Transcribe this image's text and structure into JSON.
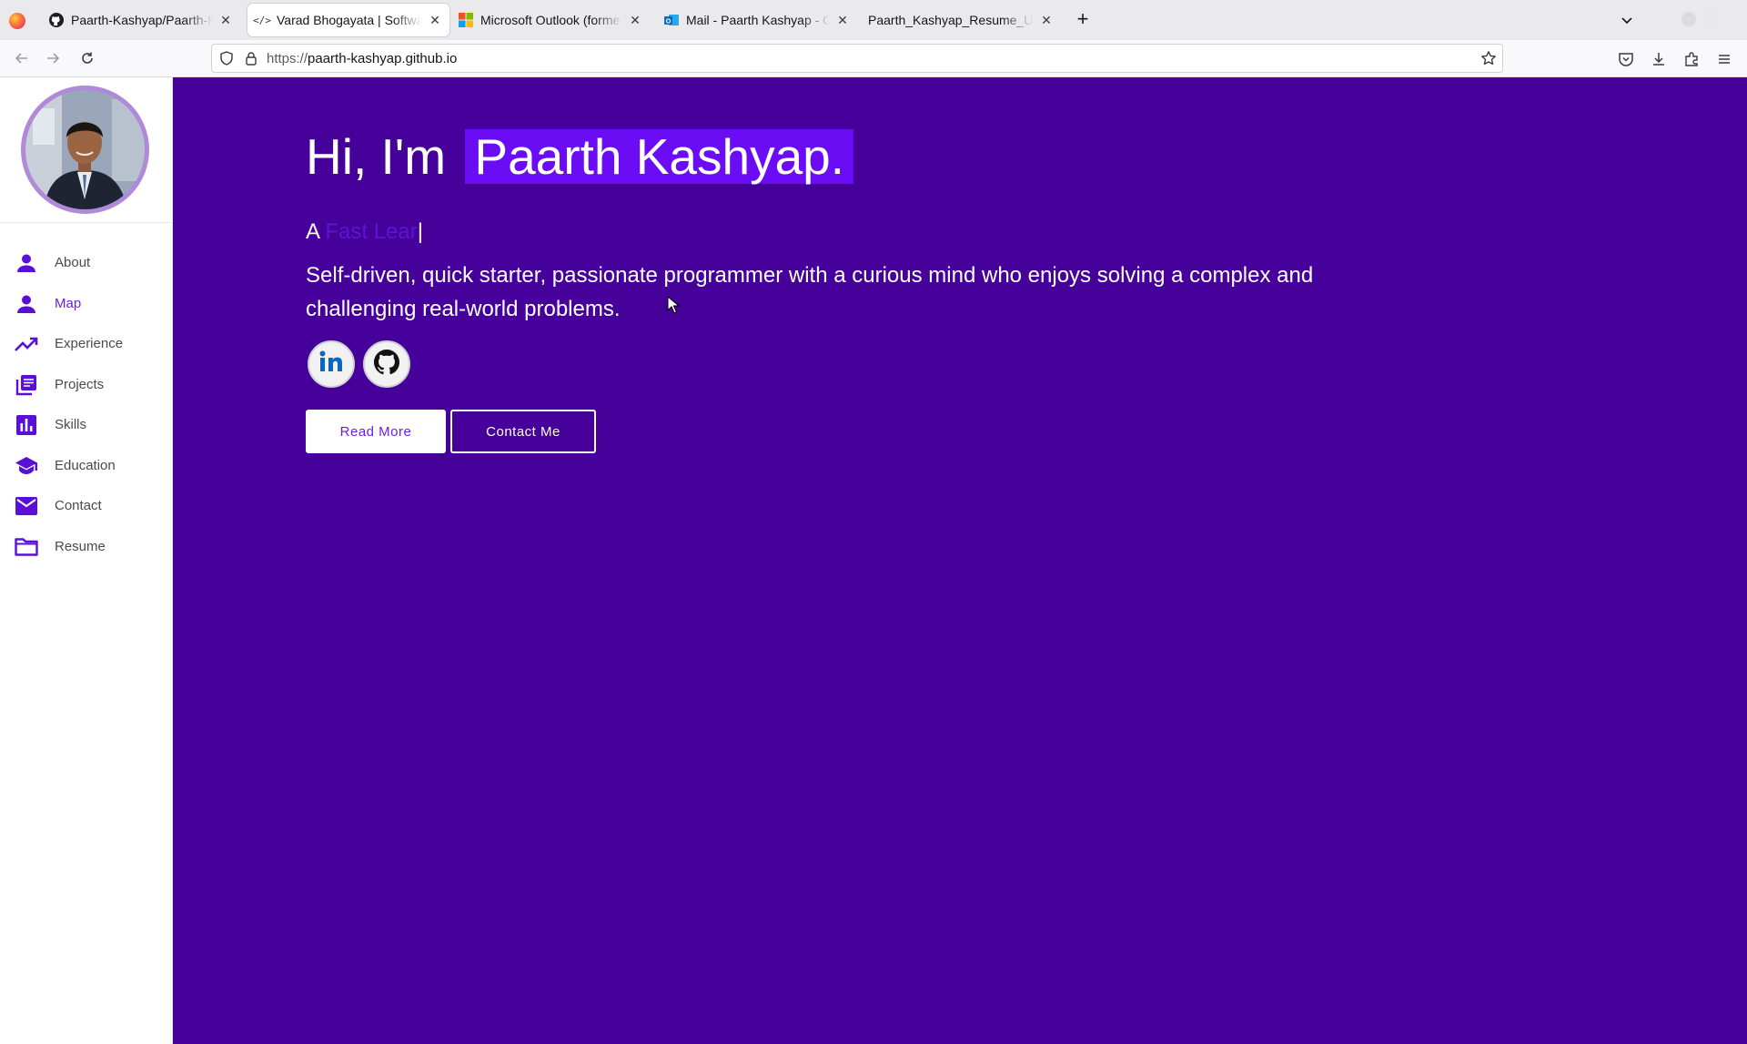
{
  "browser": {
    "tabs": [
      {
        "title": "Paarth-Kashyap/Paarth-K",
        "favicon": "github-icon",
        "active": false
      },
      {
        "title": "Varad Bhogayata | Softwa",
        "favicon": "code-icon",
        "active": true
      },
      {
        "title": "Microsoft Outlook (forme",
        "favicon": "microsoft-icon",
        "active": false
      },
      {
        "title": "Mail - Paarth Kashyap - O",
        "favicon": "outlook-icon",
        "active": false
      },
      {
        "title": "Paarth_Kashyap_Resume_Uc",
        "favicon": "",
        "active": false
      }
    ],
    "url_scheme": "https://",
    "url_host": "paarth-kashyap.github.io"
  },
  "sidebar": {
    "items": [
      {
        "label": "About",
        "icon": "person-icon"
      },
      {
        "label": "Map",
        "icon": "person-icon"
      },
      {
        "label": "Experience",
        "icon": "trending-up-icon"
      },
      {
        "label": "Projects",
        "icon": "articles-icon"
      },
      {
        "label": "Skills",
        "icon": "bar-chart-icon"
      },
      {
        "label": "Education",
        "icon": "graduation-cap-icon"
      },
      {
        "label": "Contact",
        "icon": "mail-icon"
      },
      {
        "label": "Resume",
        "icon": "folder-icon"
      }
    ]
  },
  "hero": {
    "greeting": "Hi, I'm",
    "name": "Paarth Kashyap.",
    "role_prefix": "A",
    "role_typed": "Fast Lear",
    "cursor": "|",
    "bio": "Self-driven, quick starter, passionate programmer with a curious mind who enjoys solving a complex and challenging real-world problems.",
    "read_more": "Read More",
    "contact_me": "Contact Me"
  },
  "colors": {
    "main_bg": "#450199",
    "name_highlight": "#6a0df5",
    "accent": "#6a1ee8",
    "sidebar_icon": "#5a0fd6"
  }
}
